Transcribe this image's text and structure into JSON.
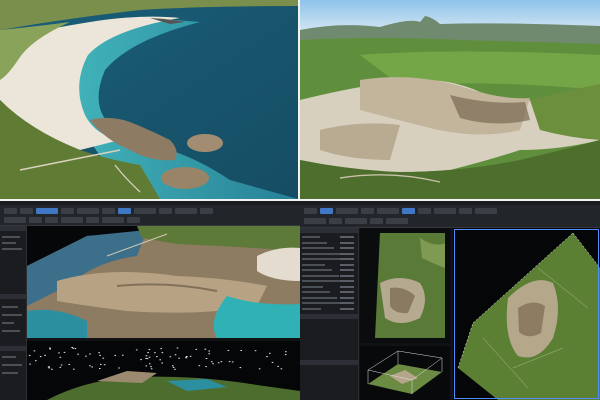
{
  "photos": [
    {
      "id": "coast",
      "alt_name": "aerial-coastline-photo"
    },
    {
      "id": "quarry",
      "alt_name": "aerial-quarry-photo"
    }
  ],
  "apps": [
    {
      "id": "left",
      "name": "photogrammetry-window-left"
    },
    {
      "id": "right",
      "name": "photogrammetry-window-right"
    }
  ],
  "colors": {
    "sea_deep": "#1d5d73",
    "sea_shallow": "#3fb8c0",
    "sand": "#e8e1d4",
    "grass": "#6e8a3c",
    "rock": "#b59b7c",
    "sky": "#a9cde8",
    "ui_bg": "#111214",
    "ui_panel": "#1a1c1f",
    "ui_accent": "#4e8cff"
  }
}
